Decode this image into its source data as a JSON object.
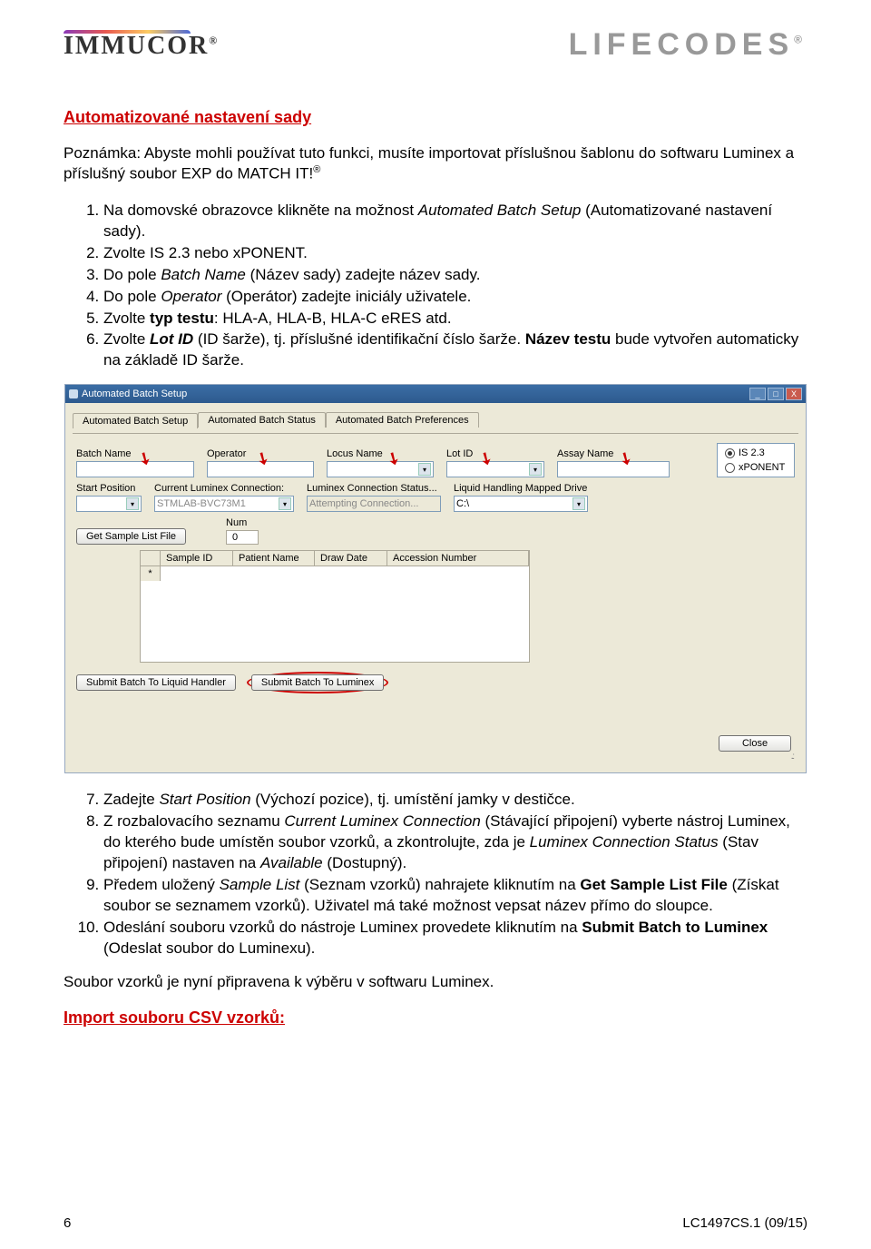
{
  "header": {
    "immucor": "IMMUCOR",
    "lifecodes": "LIFECODES"
  },
  "section_title": "Automatizované nastavení sady",
  "note": {
    "prefix": "Poznámka: Abyste mohli používat tuto funkci, musíte importovat příslušnou šablonu do softwaru Luminex a příslušný soubor EXP do ",
    "match_it": "MATCH IT!",
    "reg": "®"
  },
  "steps1": [
    {
      "t": "Na domovské obrazovce klikněte na možnost ",
      "i": "Automated Batch Setup",
      "t2": " (Automatizované nastavení sady)."
    },
    {
      "t": "Zvolte IS 2.3 nebo xPONENT."
    },
    {
      "t": "Do pole ",
      "i": "Batch Name",
      "t2": " (Název sady) zadejte název sady."
    },
    {
      "t": "Do pole ",
      "i": "Operator",
      "t2": " (Operátor) zadejte iniciály uživatele."
    },
    {
      "t": "Zvolte ",
      "b": "typ testu",
      "t2": ": HLA-A, HLA-B, HLA-C eRES atd."
    },
    {
      "t": "Zvolte ",
      "bi": "Lot ID",
      "t2": " (ID šarže), tj. příslušné identifikační číslo šarže. ",
      "b2": "Název testu",
      "t3": " bude vytvořen automaticky na základě ID šarže."
    }
  ],
  "app": {
    "title": "Automated Batch Setup",
    "tabs": [
      "Automated Batch Setup",
      "Automated Batch Status",
      "Automated Batch Preferences"
    ],
    "labels": {
      "batch_name": "Batch Name",
      "operator": "Operator",
      "locus_name": "Locus Name",
      "lot_id": "Lot ID",
      "assay_name": "Assay Name",
      "start_position": "Start Position",
      "current_conn": "Current Luminex Connection:",
      "conn_status": "Luminex Connection Status...",
      "conn_status_val": "Attempting Connection...",
      "liquid_drive": "Liquid Handling Mapped Drive",
      "liquid_drive_val": "C:\\",
      "conn_val": "STMLAB-BVC73M1",
      "get_sample_file": "Get Sample List File",
      "num_label": "Num",
      "num_val": "0",
      "radio_is": "IS 2.3",
      "radio_xp": "xPONENT",
      "grid_cols": [
        "Sample ID",
        "Patient Name",
        "Draw Date",
        "Accession Number"
      ],
      "submit_liquid": "Submit Batch To Liquid Handler",
      "submit_luminex": "Submit Batch To Luminex",
      "close": "Close"
    },
    "winbtns": {
      "min": "_",
      "max": "□",
      "close": "X"
    }
  },
  "steps2": [
    {
      "n": "7.",
      "t": "Zadejte ",
      "i": "Start Position",
      "t2": " (Výchozí pozice), tj. umístění jamky v destičce."
    },
    {
      "n": "8.",
      "t": "Z rozbalovacího seznamu ",
      "i": "Current Luminex Connection",
      "t2": " (Stávající připojení) vyberte nástroj Luminex, do kterého bude umístěn soubor vzorků, a zkontrolujte, zda je ",
      "i2": "Luminex Connection Status",
      "t3": " (Stav připojení) nastaven na ",
      "i3": "Available",
      "t4": " (Dostupný)."
    },
    {
      "n": "9.",
      "t": "Předem uložený ",
      "i": "Sample List",
      "t2": " (Seznam vzorků) nahrajete kliknutím na ",
      "b": "Get Sample List File",
      "t3": " (Získat soubor se seznamem vzorků). Uživatel má také možnost vepsat název přímo do sloupce."
    },
    {
      "n": "10.",
      "t": "Odeslání souboru vzorků do nástroje Luminex provedete kliknutím na ",
      "b": "Submit Batch to Luminex",
      "t2": " (Odeslat soubor do Luminexu)."
    }
  ],
  "closing": "Soubor vzorků je nyní připravena k výběru v softwaru Luminex.",
  "import_link": "Import souboru CSV vzorků:",
  "footer": {
    "page": "6",
    "code": "LC1497CS.1 (09/15)"
  }
}
